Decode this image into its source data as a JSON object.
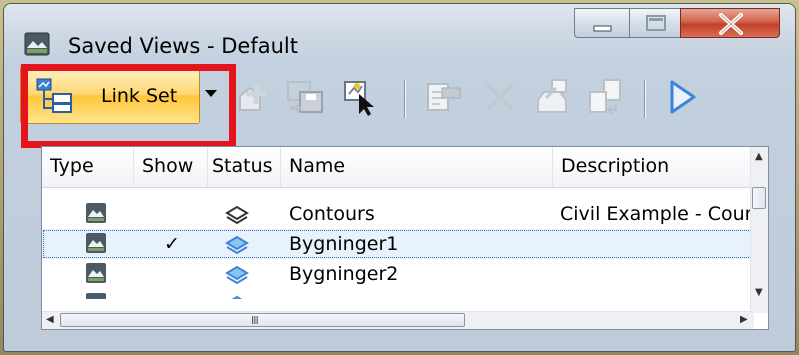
{
  "window": {
    "title": "Saved Views - Default",
    "controls": {
      "minimize": "minimize",
      "maximize": "maximize",
      "close": "close"
    }
  },
  "toolbar": {
    "link_set_label": "Link Set",
    "icons": [
      "link-set-icon",
      "dropdown-arrow-icon",
      "insert-view-icon",
      "save-view-icon",
      "select-view-icon",
      "properties-icon",
      "delete-icon",
      "export-icon",
      "import-icon",
      "apply-icon"
    ]
  },
  "list": {
    "columns": [
      "Type",
      "Show",
      "Status",
      "Name",
      "Description"
    ],
    "rows": [
      {
        "show": "",
        "name": "Contours",
        "description": "Civil Example - Coun"
      },
      {
        "show": "✓",
        "name": "Bygninger1",
        "description": ""
      },
      {
        "show": "",
        "name": "Bygninger2",
        "description": ""
      }
    ],
    "hscroll_grip": "III"
  },
  "colors": {
    "highlight": "#e3141b",
    "button_accent": "#ffc63a",
    "selection": "#e8f2fc",
    "close_button": "#c2412b"
  }
}
